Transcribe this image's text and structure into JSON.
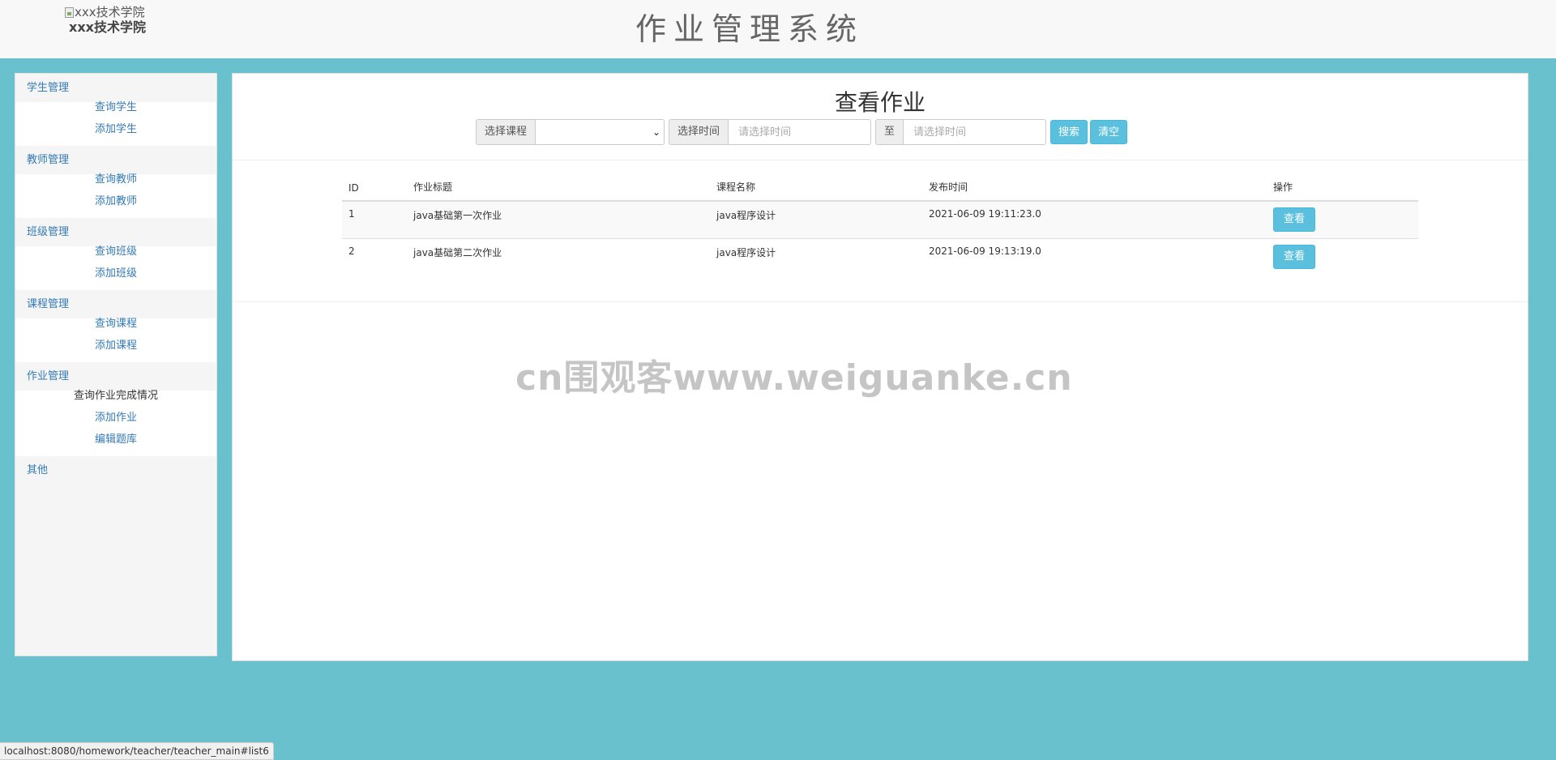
{
  "header": {
    "logo_alt": "xxx技术学院",
    "logo_text": "xxx技术学院",
    "system_title": "作业管理系统"
  },
  "sidebar": {
    "groups": [
      {
        "title": "学生管理",
        "items": [
          "查询学生",
          "添加学生"
        ]
      },
      {
        "title": "教师管理",
        "items": [
          "查询教师",
          "添加教师"
        ]
      },
      {
        "title": "班级管理",
        "items": [
          "查询班级",
          "添加班级"
        ]
      },
      {
        "title": "课程管理",
        "items": [
          "查询课程",
          "添加课程"
        ]
      },
      {
        "title": "作业管理",
        "items": [
          "查询作业完成情况",
          "添加作业",
          "编辑题库"
        ]
      },
      {
        "title": "其他",
        "items": []
      }
    ]
  },
  "main": {
    "title": "查看作业",
    "search": {
      "course_label": "选择课程",
      "course_value": "",
      "time_label": "选择时间",
      "time_start_placeholder": "请选择时间",
      "to_label": "至",
      "time_end_placeholder": "请选择时间",
      "search_button": "搜索",
      "clear_button": "清空"
    },
    "table": {
      "headers": [
        "ID",
        "作业标题",
        "课程名称",
        "发布时间",
        "操作"
      ],
      "rows": [
        {
          "id": "1",
          "title": "java基础第一次作业",
          "course": "java程序设计",
          "time": "2021-06-09 19:11:23.0",
          "action": "查看"
        },
        {
          "id": "2",
          "title": "java基础第二次作业",
          "course": "java程序设计",
          "time": "2021-06-09 19:13:19.0",
          "action": "查看"
        }
      ]
    }
  },
  "watermark": "cn围观客www.weiguanke.cn",
  "status_url": "localhost:8080/homework/teacher/teacher_main#list6",
  "colors": {
    "background": "#68c1cc",
    "link": "#337ab7",
    "info_button": "#5bc0de"
  }
}
